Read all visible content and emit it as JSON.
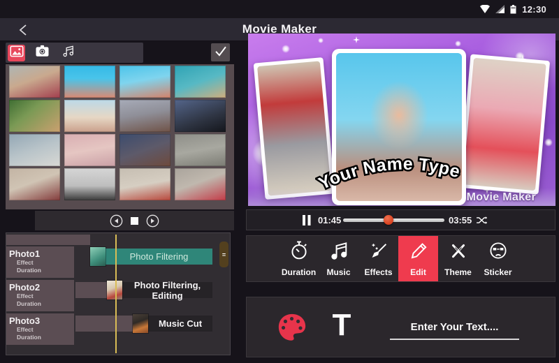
{
  "status_bar": {
    "time": "12:30",
    "icons": [
      "wifi-icon",
      "signal-icon",
      "battery-icon"
    ]
  },
  "title_bar": {
    "title": "Movie Maker",
    "back_icon": "back-chevron"
  },
  "media_panel": {
    "tabs": [
      {
        "icon": "image-icon",
        "selected": true
      },
      {
        "icon": "camera-icon",
        "selected": false
      },
      {
        "icon": "music-icon",
        "selected": false
      }
    ],
    "confirm_icon": "check-icon",
    "photo_grid_rows": 4,
    "photo_grid_cols": 4
  },
  "transport": {
    "buttons": [
      "previous",
      "stop",
      "next"
    ]
  },
  "timeline": {
    "tracks": [
      {
        "label": "Photo1",
        "sub": [
          "Effect",
          "Duration"
        ],
        "clip": "Photo Filtering"
      },
      {
        "label": "Photo2",
        "sub": [
          "Effect",
          "Duration"
        ],
        "clip": "Photo Filtering, Editing"
      },
      {
        "label": "Photo3",
        "sub": [
          "Effect",
          "Duration"
        ],
        "clip": "Music Cut"
      }
    ]
  },
  "preview": {
    "caption": "Your Name Type",
    "watermark": "Movie Maker"
  },
  "player": {
    "elapsed": "01:45",
    "duration": "03:55",
    "progress_pct": 45,
    "state": "playing"
  },
  "toolbar": {
    "items": [
      {
        "label": "Duration",
        "icon": "stopwatch-icon",
        "active": false
      },
      {
        "label": "Music",
        "icon": "music-note-icon",
        "active": false
      },
      {
        "label": "Effects",
        "icon": "broom-icon",
        "active": false
      },
      {
        "label": "Edit",
        "icon": "pencil-icon",
        "active": true
      },
      {
        "label": "Theme",
        "icon": "crossed-wands-icon",
        "active": false
      },
      {
        "label": "Sticker",
        "icon": "sticker-face-icon",
        "active": false
      }
    ]
  },
  "text_tool": {
    "t_label": "T",
    "placeholder": "Enter Your Text...."
  },
  "colors": {
    "accent_red": "#ef3b4e",
    "teal_clip": "#2f8679",
    "playhead_yellow": "#d9bc55",
    "preview_purple": "#a95fe0",
    "panel_dark": "#2b272c",
    "thumb_orange": "#d8401e"
  }
}
